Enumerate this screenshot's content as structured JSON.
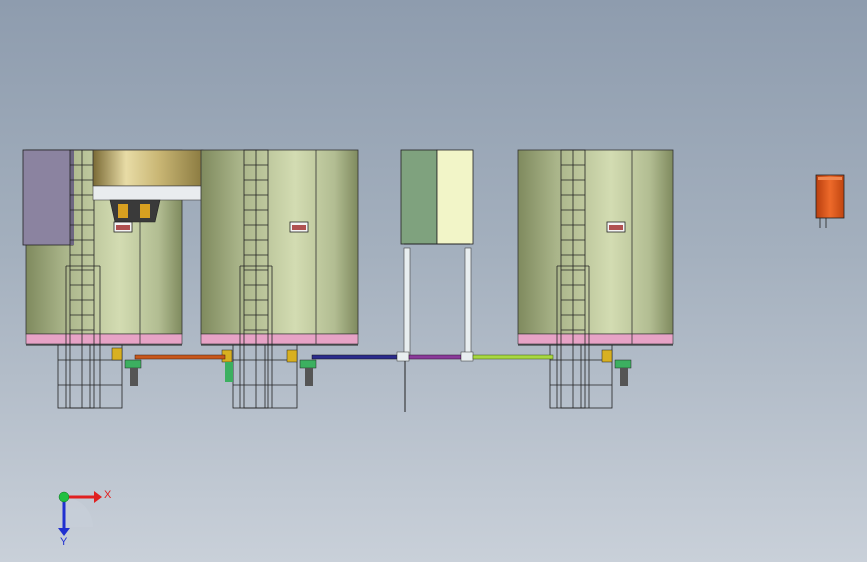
{
  "viewport": {
    "background_top": "#8e9cae",
    "background_bottom": "#c9d0d9"
  },
  "colors": {
    "tank_body": "#c9d3a6",
    "tank_shade": "#8f9a6e",
    "tank_bottom_band": "#e7a3c6",
    "control_cabinet": "#8b83a0",
    "hopper_gold": "#c8b77a",
    "panel_green": "#7fa27e",
    "panel_yellow": "#f2f5c8",
    "orange_device": "#e0541a",
    "pipe_orange": "#c8571c",
    "pipe_blue": "#2a2a8c",
    "pipe_purple": "#8a3a9a",
    "pipe_lime": "#a8d840",
    "pipe_white": "#e8eef0",
    "frame_line": "#1e1e1e"
  },
  "axes": {
    "x_label": "X",
    "y_label": "Y",
    "x_color": "#e02020",
    "y_color": "#2030d0",
    "origin_color": "#20c040"
  },
  "objects": [
    {
      "name": "tank-unit-1",
      "icon": "silo-tank-icon"
    },
    {
      "name": "tank-unit-2",
      "icon": "silo-tank-icon"
    },
    {
      "name": "electrical-panel",
      "icon": "cabinet-icon"
    },
    {
      "name": "tank-unit-3",
      "icon": "silo-tank-icon"
    },
    {
      "name": "orange-device",
      "icon": "junction-box-icon"
    }
  ]
}
